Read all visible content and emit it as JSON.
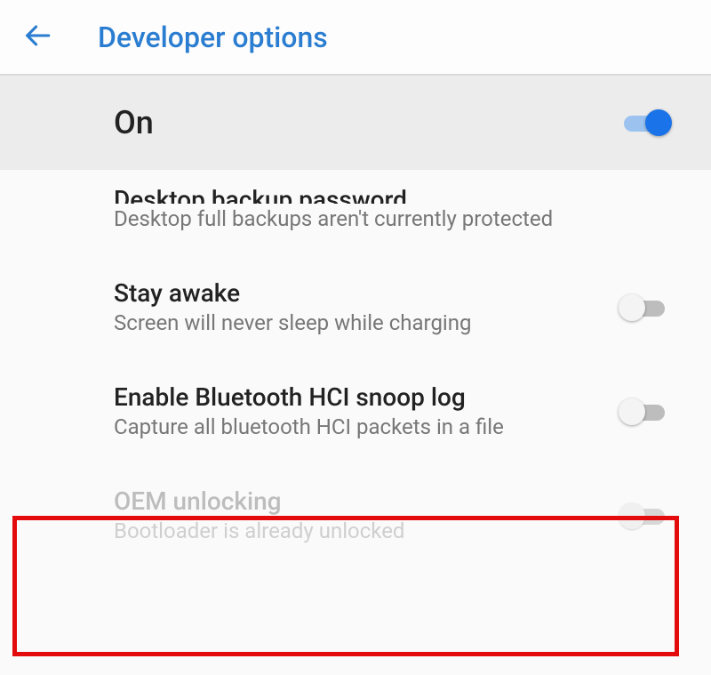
{
  "header": {
    "title": "Developer options"
  },
  "master": {
    "label": "On",
    "state": "on"
  },
  "rows": [
    {
      "id": "desktop-backup-password",
      "title": "Desktop backup password",
      "sub": "Desktop full backups aren't currently protected",
      "toggle": null,
      "disabled": false
    },
    {
      "id": "stay-awake",
      "title": "Stay awake",
      "sub": "Screen will never sleep while charging",
      "toggle": "off",
      "disabled": false
    },
    {
      "id": "enable-bt-hci-snoop",
      "title": "Enable Bluetooth HCI snoop log",
      "sub": "Capture all bluetooth HCI packets in a file",
      "toggle": "off",
      "disabled": false
    },
    {
      "id": "oem-unlocking",
      "title": "OEM unlocking",
      "sub": "Bootloader is already unlocked",
      "toggle": "off",
      "disabled": true
    }
  ],
  "annotations": {
    "highlight_row_id": "oem-unlocking"
  }
}
